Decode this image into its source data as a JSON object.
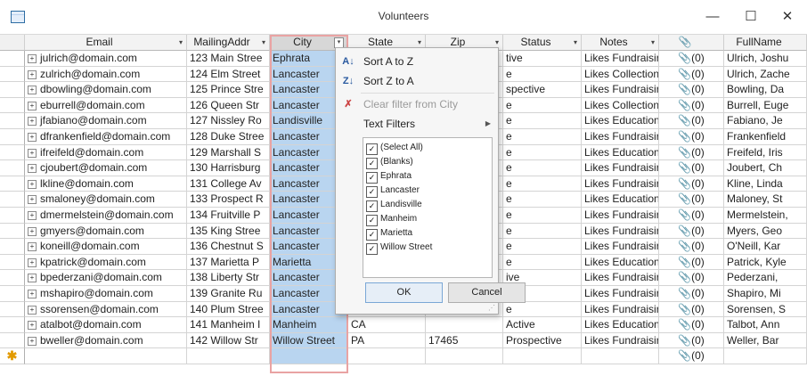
{
  "window": {
    "title": "Volunteers",
    "minimize": "—",
    "maximize": "☐",
    "close": "✕"
  },
  "columns": [
    {
      "label": "Email",
      "arrow": "▾"
    },
    {
      "label": "MailingAddr",
      "arrow": "▾"
    },
    {
      "label": "City",
      "arrow": "▾"
    },
    {
      "label": "State",
      "arrow": "▾"
    },
    {
      "label": "Zip",
      "arrow": "▾"
    },
    {
      "label": "Status",
      "arrow": "▾"
    },
    {
      "label": "Notes",
      "arrow": "▾"
    },
    {
      "label": "📎",
      "arrow": ""
    },
    {
      "label": "FullName",
      "arrow": ""
    }
  ],
  "rows": [
    [
      "julrich@domain.com",
      "123 Main Stree",
      "Ephrata",
      "",
      "",
      "tive",
      "Likes Fundraisir",
      "📎(0)",
      "Ulrich, Joshu"
    ],
    [
      "zulrich@domain.com",
      "124 Elm Street",
      "Lancaster",
      "",
      "",
      "e",
      "Likes Collection",
      "📎(0)",
      "Ulrich, Zache"
    ],
    [
      "dbowling@domain.com",
      "125 Prince Stre",
      "Lancaster",
      "",
      "",
      "spective",
      "Likes Fundraisir",
      "📎(0)",
      "Bowling, Da"
    ],
    [
      "eburrell@domain.com",
      "126 Queen Str",
      "Lancaster",
      "",
      "",
      "e",
      "Likes Collection",
      "📎(0)",
      "Burrell, Euge"
    ],
    [
      "jfabiano@domain.com",
      "127 Nissley Ro",
      "Landisville",
      "",
      "",
      "e",
      "Likes Education",
      "📎(0)",
      "Fabiano, Je"
    ],
    [
      "dfrankenfield@domain.com",
      "128 Duke Stree",
      "Lancaster",
      "",
      "",
      "e",
      "Likes Fundraisir",
      "📎(0)",
      "Frankenfield"
    ],
    [
      "ifreifeld@domain.com",
      "129 Marshall S",
      "Lancaster",
      "",
      "",
      "e",
      "Likes Education",
      "📎(0)",
      "Freifeld, Iris"
    ],
    [
      "cjoubert@domain.com",
      "130 Harrisburg",
      "Lancaster",
      "",
      "",
      "e",
      "Likes Fundraisir",
      "📎(0)",
      "Joubert, Ch"
    ],
    [
      "lkline@domain.com",
      "131 College Av",
      "Lancaster",
      "",
      "",
      "e",
      "Likes Fundraisir",
      "📎(0)",
      "Kline, Linda"
    ],
    [
      "smaloney@domain.com",
      "133 Prospect R",
      "Lancaster",
      "",
      "",
      "e",
      "Likes Education",
      "📎(0)",
      "Maloney, St"
    ],
    [
      "dmermelstein@domain.com",
      "134 Fruitville P",
      "Lancaster",
      "",
      "",
      "e",
      "Likes Fundraisir",
      "📎(0)",
      "Mermelstein,"
    ],
    [
      "gmyers@domain.com",
      "135 King Stree",
      "Lancaster",
      "",
      "",
      "e",
      "Likes Fundraisir",
      "📎(0)",
      "Myers, Geo"
    ],
    [
      "koneill@domain.com",
      "136 Chestnut S",
      "Lancaster",
      "",
      "",
      "e",
      "Likes Fundraisir",
      "📎(0)",
      "O'Neill, Kar"
    ],
    [
      "kpatrick@domain.com",
      "137 Marietta P",
      "Marietta",
      "",
      "",
      "e",
      "Likes Education",
      "📎(0)",
      "Patrick, Kyle"
    ],
    [
      "bpederzani@domain.com",
      "138 Liberty Str",
      "Lancaster",
      "",
      "",
      "ive",
      "Likes Fundraisir",
      "📎(0)",
      "Pederzani,"
    ],
    [
      "mshapiro@domain.com",
      "139 Granite Ru",
      "Lancaster",
      "",
      "",
      "e",
      "Likes Fundraisir",
      "📎(0)",
      "Shapiro, Mi"
    ],
    [
      "ssorensen@domain.com",
      "140 Plum Stree",
      "Lancaster",
      "",
      "",
      "e",
      "Likes Fundraisir",
      "📎(0)",
      "Sorensen, S"
    ],
    [
      "atalbot@domain.com",
      "141 Manheim I",
      "Manheim",
      "CA",
      "",
      "Active",
      "Likes Education",
      "📎(0)",
      "Talbot, Ann"
    ],
    [
      "bweller@domain.com",
      "142 Willow Str",
      "Willow Street",
      "PA",
      "17465",
      "Prospective",
      "Likes Fundraisir",
      "📎(0)",
      "Weller, Bar"
    ]
  ],
  "new_row": {
    "marker": "✱",
    "attachment": "📎(0)"
  },
  "popup": {
    "sort_az": "Sort A to Z",
    "sort_za": "Sort Z to A",
    "clear_filter": "Clear filter from City",
    "text_filters": "Text Filters",
    "checklist": [
      "(Select All)",
      "(Blanks)",
      "Ephrata",
      "Lancaster",
      "Landisville",
      "Manheim",
      "Marietta",
      "Willow Street"
    ],
    "ok": "OK",
    "cancel": "Cancel"
  }
}
